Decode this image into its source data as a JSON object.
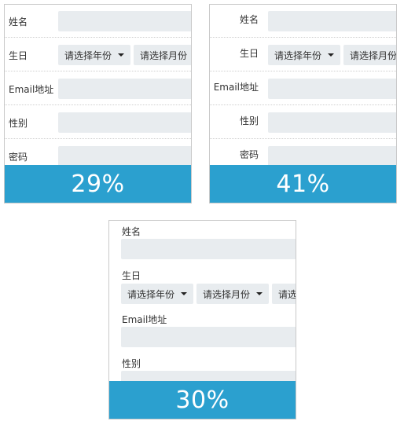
{
  "form": {
    "name_label": "姓名",
    "birthday_label": "生日",
    "email_label": "Email地址",
    "gender_label": "性别",
    "password_label": "密码",
    "year_select": "请选择年份",
    "month_select": "请选择月份",
    "day_select_partial": "请选"
  },
  "panels": [
    {
      "progress_text": "29%",
      "progress_value": 0.29
    },
    {
      "progress_text": "41%",
      "progress_value": 0.41
    },
    {
      "progress_text": "30%",
      "progress_value": 0.3
    }
  ],
  "colors": {
    "accent": "#2ba0cf",
    "field_bg": "#e8ecef",
    "border": "#c9c9c9"
  }
}
